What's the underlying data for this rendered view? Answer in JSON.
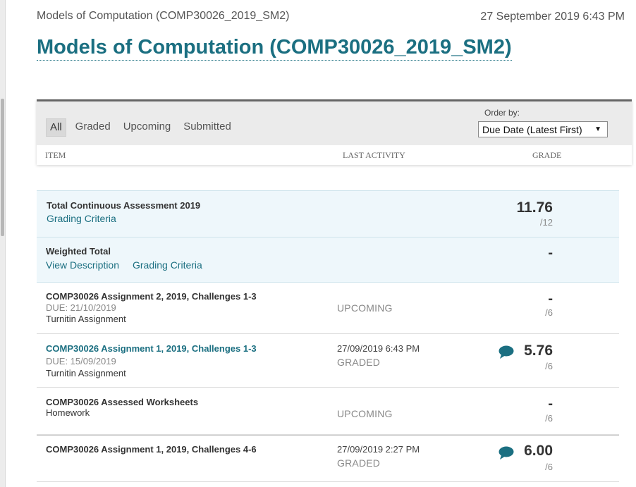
{
  "header": {
    "breadcrumb": "Models of Computation (COMP30026_2019_SM2)",
    "timestamp": "27 September 2019 6:43 PM",
    "title": "Models of Computation (COMP30026_2019_SM2)"
  },
  "filters": {
    "items": [
      {
        "label": "All",
        "active": true
      },
      {
        "label": "Graded",
        "active": false
      },
      {
        "label": "Upcoming",
        "active": false
      },
      {
        "label": "Submitted",
        "active": false
      }
    ],
    "order_label": "Order by:",
    "order_value": "Due Date (Latest First)"
  },
  "columns": {
    "item": "ITEM",
    "last_activity": "LAST ACTIVITY",
    "grade": "GRADE"
  },
  "rows": [
    {
      "title": "Total Continuous Assessment 2019",
      "link1": "Grading Criteria",
      "grade": "11.76",
      "out_of": "/12"
    },
    {
      "title": "Weighted Total",
      "link1": "View Description",
      "link2": "Grading Criteria",
      "grade": "-"
    },
    {
      "title": "COMP30026 Assignment 2, 2019, Challenges 1-3",
      "due": "DUE: 21/10/2019",
      "type": "Turnitin Assignment",
      "status": "UPCOMING",
      "grade": "-",
      "out_of": "/6"
    },
    {
      "title": "COMP30026 Assignment 1, 2019, Challenges 1-3",
      "due": "DUE: 15/09/2019",
      "type": "Turnitin Assignment",
      "activity_date": "27/09/2019 6:43 PM",
      "status": "GRADED",
      "grade": "5.76",
      "out_of": "/6"
    },
    {
      "title": "COMP30026 Assessed Worksheets",
      "type": "Homework",
      "status": "UPCOMING",
      "grade": "-",
      "out_of": "/6"
    },
    {
      "title": "COMP30026 Assignment 1, 2019, Challenges 4-6",
      "activity_date": "27/09/2019 2:27 PM",
      "status": "GRADED",
      "grade": "6.00",
      "out_of": "/6"
    }
  ],
  "icons": {
    "comment": "speech-bubble-icon",
    "dropdown": "triangle-down-icon"
  },
  "colors": {
    "accent": "#1b6f81",
    "highlight_row": "#eef7fb"
  }
}
